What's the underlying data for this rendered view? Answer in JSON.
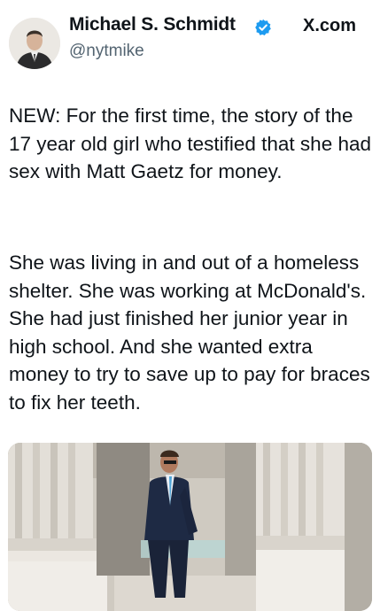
{
  "author": {
    "name": "Michael S. Schmidt",
    "handle": "@nytmike",
    "verified": true,
    "avatar_icon": "person-avatar"
  },
  "source": "X.com",
  "post": {
    "paragraph1": "NEW:  For the first time, the story of the 17 year old girl who testified that she had sex with Matt Gaetz for money.",
    "paragraph2": "She was living in and out of a homeless shelter. She was working at McDonald's. She had just finished her junior year in high school. And she wanted extra money to try to save up to pay for braces to fix her teeth."
  },
  "colors": {
    "verified_badge": "#1d9bf0",
    "handle": "#536471",
    "text": "#0f1419"
  }
}
